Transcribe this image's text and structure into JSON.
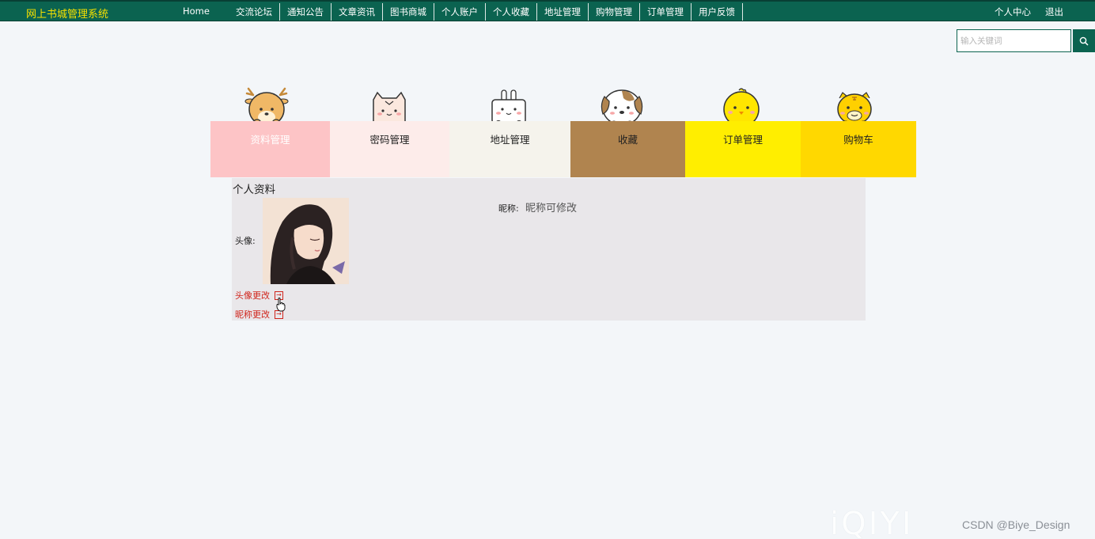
{
  "header": {
    "brand": "网上书城管理系统",
    "nav": [
      "Home",
      "交流论坛",
      "通知公告",
      "文章资讯",
      "图书商城",
      "个人账户",
      "个人收藏",
      "地址管理",
      "购物管理",
      "订单管理",
      "用户反馈"
    ],
    "user_center": "个人中心",
    "logout": "退出"
  },
  "search": {
    "placeholder": "输入关键词",
    "icon": "search-icon"
  },
  "tiles": [
    {
      "label": "资料管理",
      "color": "#fdc4c6",
      "icon": "deer-icon"
    },
    {
      "label": "密码管理",
      "color": "#fdecea",
      "icon": "cat-icon"
    },
    {
      "label": "地址管理",
      "color": "#f5f3ec",
      "icon": "rabbit-icon"
    },
    {
      "label": "收藏",
      "color": "#b0844f",
      "icon": "dog-icon"
    },
    {
      "label": "订单管理",
      "color": "#ffee00",
      "icon": "chick-icon"
    },
    {
      "label": "购物车",
      "color": "#ffd800",
      "icon": "tiger-icon"
    }
  ],
  "profile": {
    "title": "个人资料",
    "avatar_label": "头像:",
    "nickname_label": "昵称:",
    "nickname_value": "昵称可修改",
    "change_avatar": "头像更改",
    "change_nickname": "昵称更改"
  },
  "watermarks": {
    "iqiyi": "iQIYI",
    "csdn": "CSDN @Biye_Design"
  }
}
